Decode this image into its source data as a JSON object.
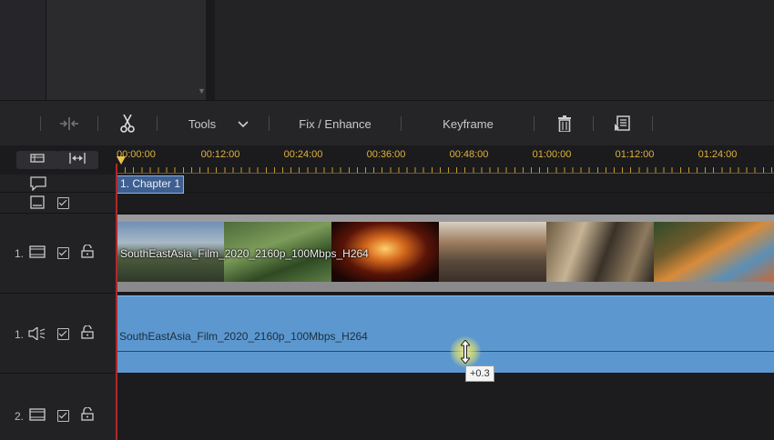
{
  "toolbar": {
    "tools_label": "Tools",
    "fix_enhance_label": "Fix / Enhance",
    "keyframe_label": "Keyframe"
  },
  "ruler": {
    "ticks": [
      "00:00:00",
      "00:12:00",
      "00:24:00",
      "00:36:00",
      "00:48:00",
      "01:00:00",
      "01:12:00",
      "01:24:00"
    ]
  },
  "chapter": {
    "label": "1. Chapter 1"
  },
  "tracks": {
    "video1_number": "1.",
    "audio1_number": "1.",
    "video2_number": "2."
  },
  "clips": {
    "video_label": "SouthEastAsia_Film_2020_2160p_100Mbps_H264",
    "audio_label": "SouthEastAsia_Film_2020_2160p_100Mbps_H264"
  },
  "tooltip": {
    "volume_value": "+0.3"
  },
  "colors": {
    "ruler_accent": "#e0b23c",
    "audio_clip": "#5c98cf",
    "playhead": "#b0282a"
  }
}
